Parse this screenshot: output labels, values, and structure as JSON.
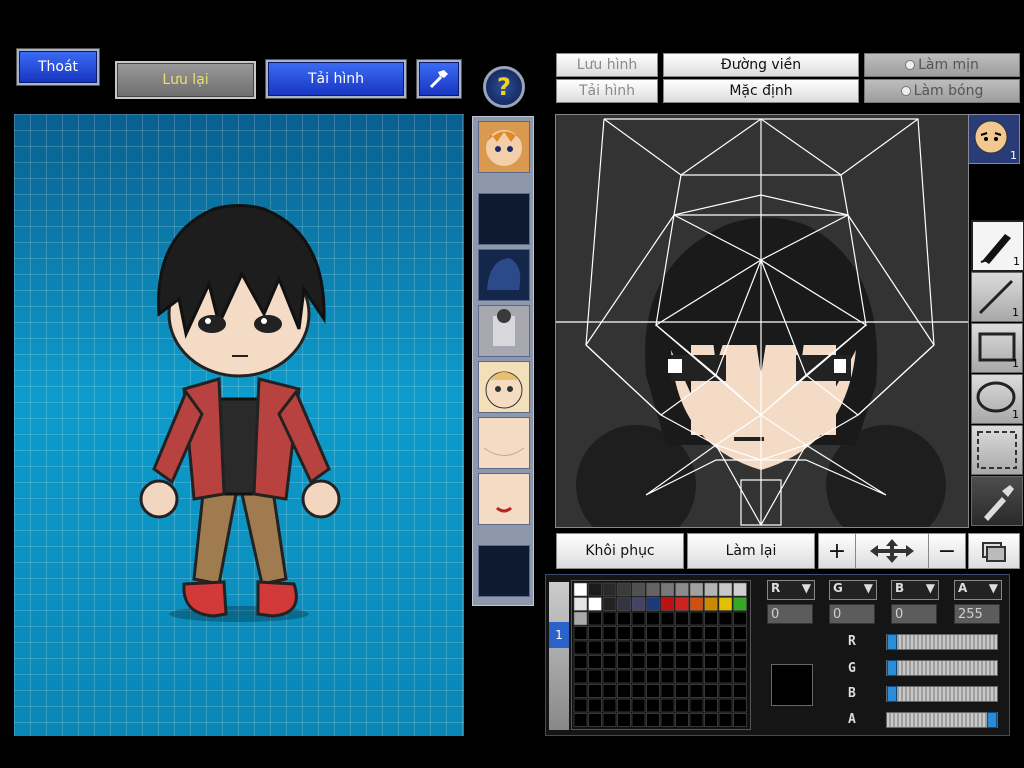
{
  "toolbar": {
    "exit_label": "Thoát",
    "save_label": "Lưu lại",
    "load_label": "Tải hình",
    "hammer_icon": "hammer-icon",
    "help_icon": "question-icon"
  },
  "editor_toolbar": {
    "save_image": "Lưu hình",
    "load_image": "Tải hình",
    "outline": "Đường viền",
    "default": "Mặc định",
    "smooth": "Làm mịn",
    "shade": "Làm bóng"
  },
  "editor_bottom": {
    "restore": "Khôi phục",
    "redo": "Làm lại"
  },
  "tools": {
    "pen_count": "1",
    "line_count": "1",
    "rect_count": "1",
    "ellipse_count": "1",
    "face_count": "1"
  },
  "color_channels": {
    "r": "0",
    "g": "0",
    "b": "0",
    "a": "255",
    "r_fill": 0,
    "g_fill": 0,
    "b_fill": 0,
    "a_fill": 1.0
  },
  "palette_colors": [
    "#ffffff",
    "#1b1b1b",
    "#2a2a2a",
    "#3c3c3c",
    "#505050",
    "#646464",
    "#787878",
    "#8c8c8c",
    "#a0a0a0",
    "#b4b4b4",
    "#c8c8c8",
    "#d0d0d0",
    "#e4e4e4",
    "#ffffff",
    "#222222",
    "#333344",
    "#444466",
    "#1c3a7a",
    "#bb1111",
    "#cc2222",
    "#d05010",
    "#cc8800",
    "#e0c000",
    "#33aa22",
    "#aaaaaa"
  ],
  "palette_tab": "1",
  "colors": {
    "accent_blue": "#2a52e0",
    "grid_bg": "#0b8fbd"
  }
}
